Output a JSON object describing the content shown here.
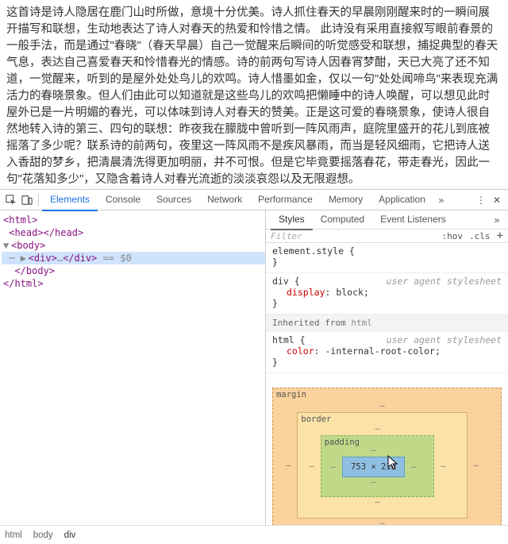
{
  "page": {
    "paragraph": "这首诗是诗人隐居在鹿门山时所做，意境十分优美。诗人抓住春天的早晨刚刚醒来时的一瞬间展开描写和联想，生动地表达了诗人对春天的热爱和怜惜之情。 此诗没有采用直接叙写眼前春景的一般手法，而是通过\"春晓\"（春天早晨）自己一觉醒来后瞬间的听觉感受和联想，捕捉典型的春天气息，表达自己喜爱春天和怜惜春光的情感。诗的前两句写诗人因春宵梦酣，天已大亮了还不知道，一觉醒来，听到的是屋外处处鸟儿的欢鸣。诗人惜墨如金，仅以一句\"处处闻啼鸟\"来表现充满活力的春晓景象。但人们由此可以知道就是这些鸟儿的欢鸣把懒睡中的诗人唤醒，可以想见此时屋外已是一片明媚的春光，可以体味到诗人对春天的赞美。正是这可爱的春晓景象，使诗人很自然地转入诗的第三、四句的联想：昨夜我在朦胧中曾听到一阵风雨声，庭院里盛开的花儿到底被摇落了多少呢？联系诗的前两句，夜里这一阵风雨不是疾风暴雨，而当是轻风细雨，它把诗人送入香甜的梦乡，把清晨清洗得更加明丽，并不可恨。但是它毕竟要摇落春花，带走春光，因此一句\"花落知多少\"，又隐含着诗人对春光流逝的淡淡哀怨以及无限遐想。"
  },
  "devtools": {
    "main_tabs": [
      "Elements",
      "Console",
      "Sources",
      "Network",
      "Performance",
      "Memory",
      "Application"
    ],
    "main_tab_active": 0,
    "dom": {
      "line1": "<html>",
      "line2_open": "<head>",
      "line2_close": "</head>",
      "line3": "<body>",
      "line4_open": "<div>",
      "line4_mid": "…",
      "line4_close": "</div>",
      "line4_eq": " == $0",
      "line5": "</body>",
      "line6": "</html>"
    },
    "styles_tabs": [
      "Styles",
      "Computed",
      "Event Listeners"
    ],
    "styles_tab_active": 0,
    "filter": {
      "placeholder": "Filter",
      "hov": ":hov",
      "cls": ".cls",
      "plus": "+"
    },
    "rules": {
      "r1_sel": "element.style {",
      "r1_close": "}",
      "r2_sel": "div {",
      "r2_prop": "display",
      "r2_val": "block",
      "r2_close": "}",
      "ua": "user agent stylesheet",
      "inherit": "Inherited from ",
      "inherit_el": "html",
      "r3_sel": "html {",
      "r3_prop": "color",
      "r3_val": "-internal-root-color",
      "r3_close": "}"
    },
    "boxmodel": {
      "margin": "margin",
      "border": "border",
      "padding": "padding",
      "content": "753 × 210",
      "dash": "–"
    },
    "breadcrumb": [
      "html",
      "body",
      "div"
    ]
  }
}
